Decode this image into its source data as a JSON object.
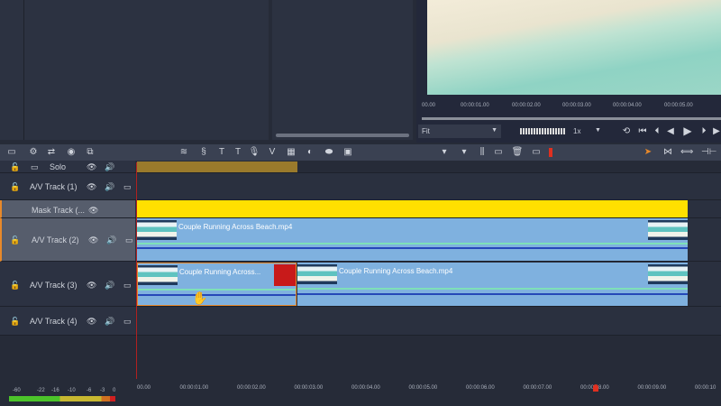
{
  "preview": {
    "fit_label": "Fit",
    "speed_label": "1x",
    "ruler": [
      "00.00",
      "00:00:01.00",
      "00:00:02.00",
      "00:00:03.00",
      "00:00:04.00",
      "00:00:05.00"
    ]
  },
  "tracks": {
    "solo": "Solo",
    "av1": "A/V Track (1)",
    "mask": "Mask Track (...",
    "av2": "A/V Track (2)",
    "av3": "A/V Track (3)",
    "av4": "A/V Track (4)"
  },
  "clips": {
    "av2_clip": "Couple Running Across Beach.mp4",
    "av3_clip_a": "Couple Running Across...",
    "av3_clip_b": "Couple Running Across Beach.mp4"
  },
  "meter": {
    "labels": [
      "-60",
      "-22",
      "-16",
      "-10",
      "-6",
      "-3",
      "0"
    ]
  },
  "timeline_ruler": [
    "00.00",
    "00:00:01.00",
    "00:00:02.00",
    "00:00:03.00",
    "00:00:04.00",
    "00:00:05.00",
    "00:00:06.00",
    "00:00:07.00",
    "00:00:08.00",
    "00:00:09.00",
    "00:00:10"
  ],
  "colors": {
    "mask": "#ffe000",
    "clip": "#7fb1df",
    "accent": "#e8892a"
  }
}
